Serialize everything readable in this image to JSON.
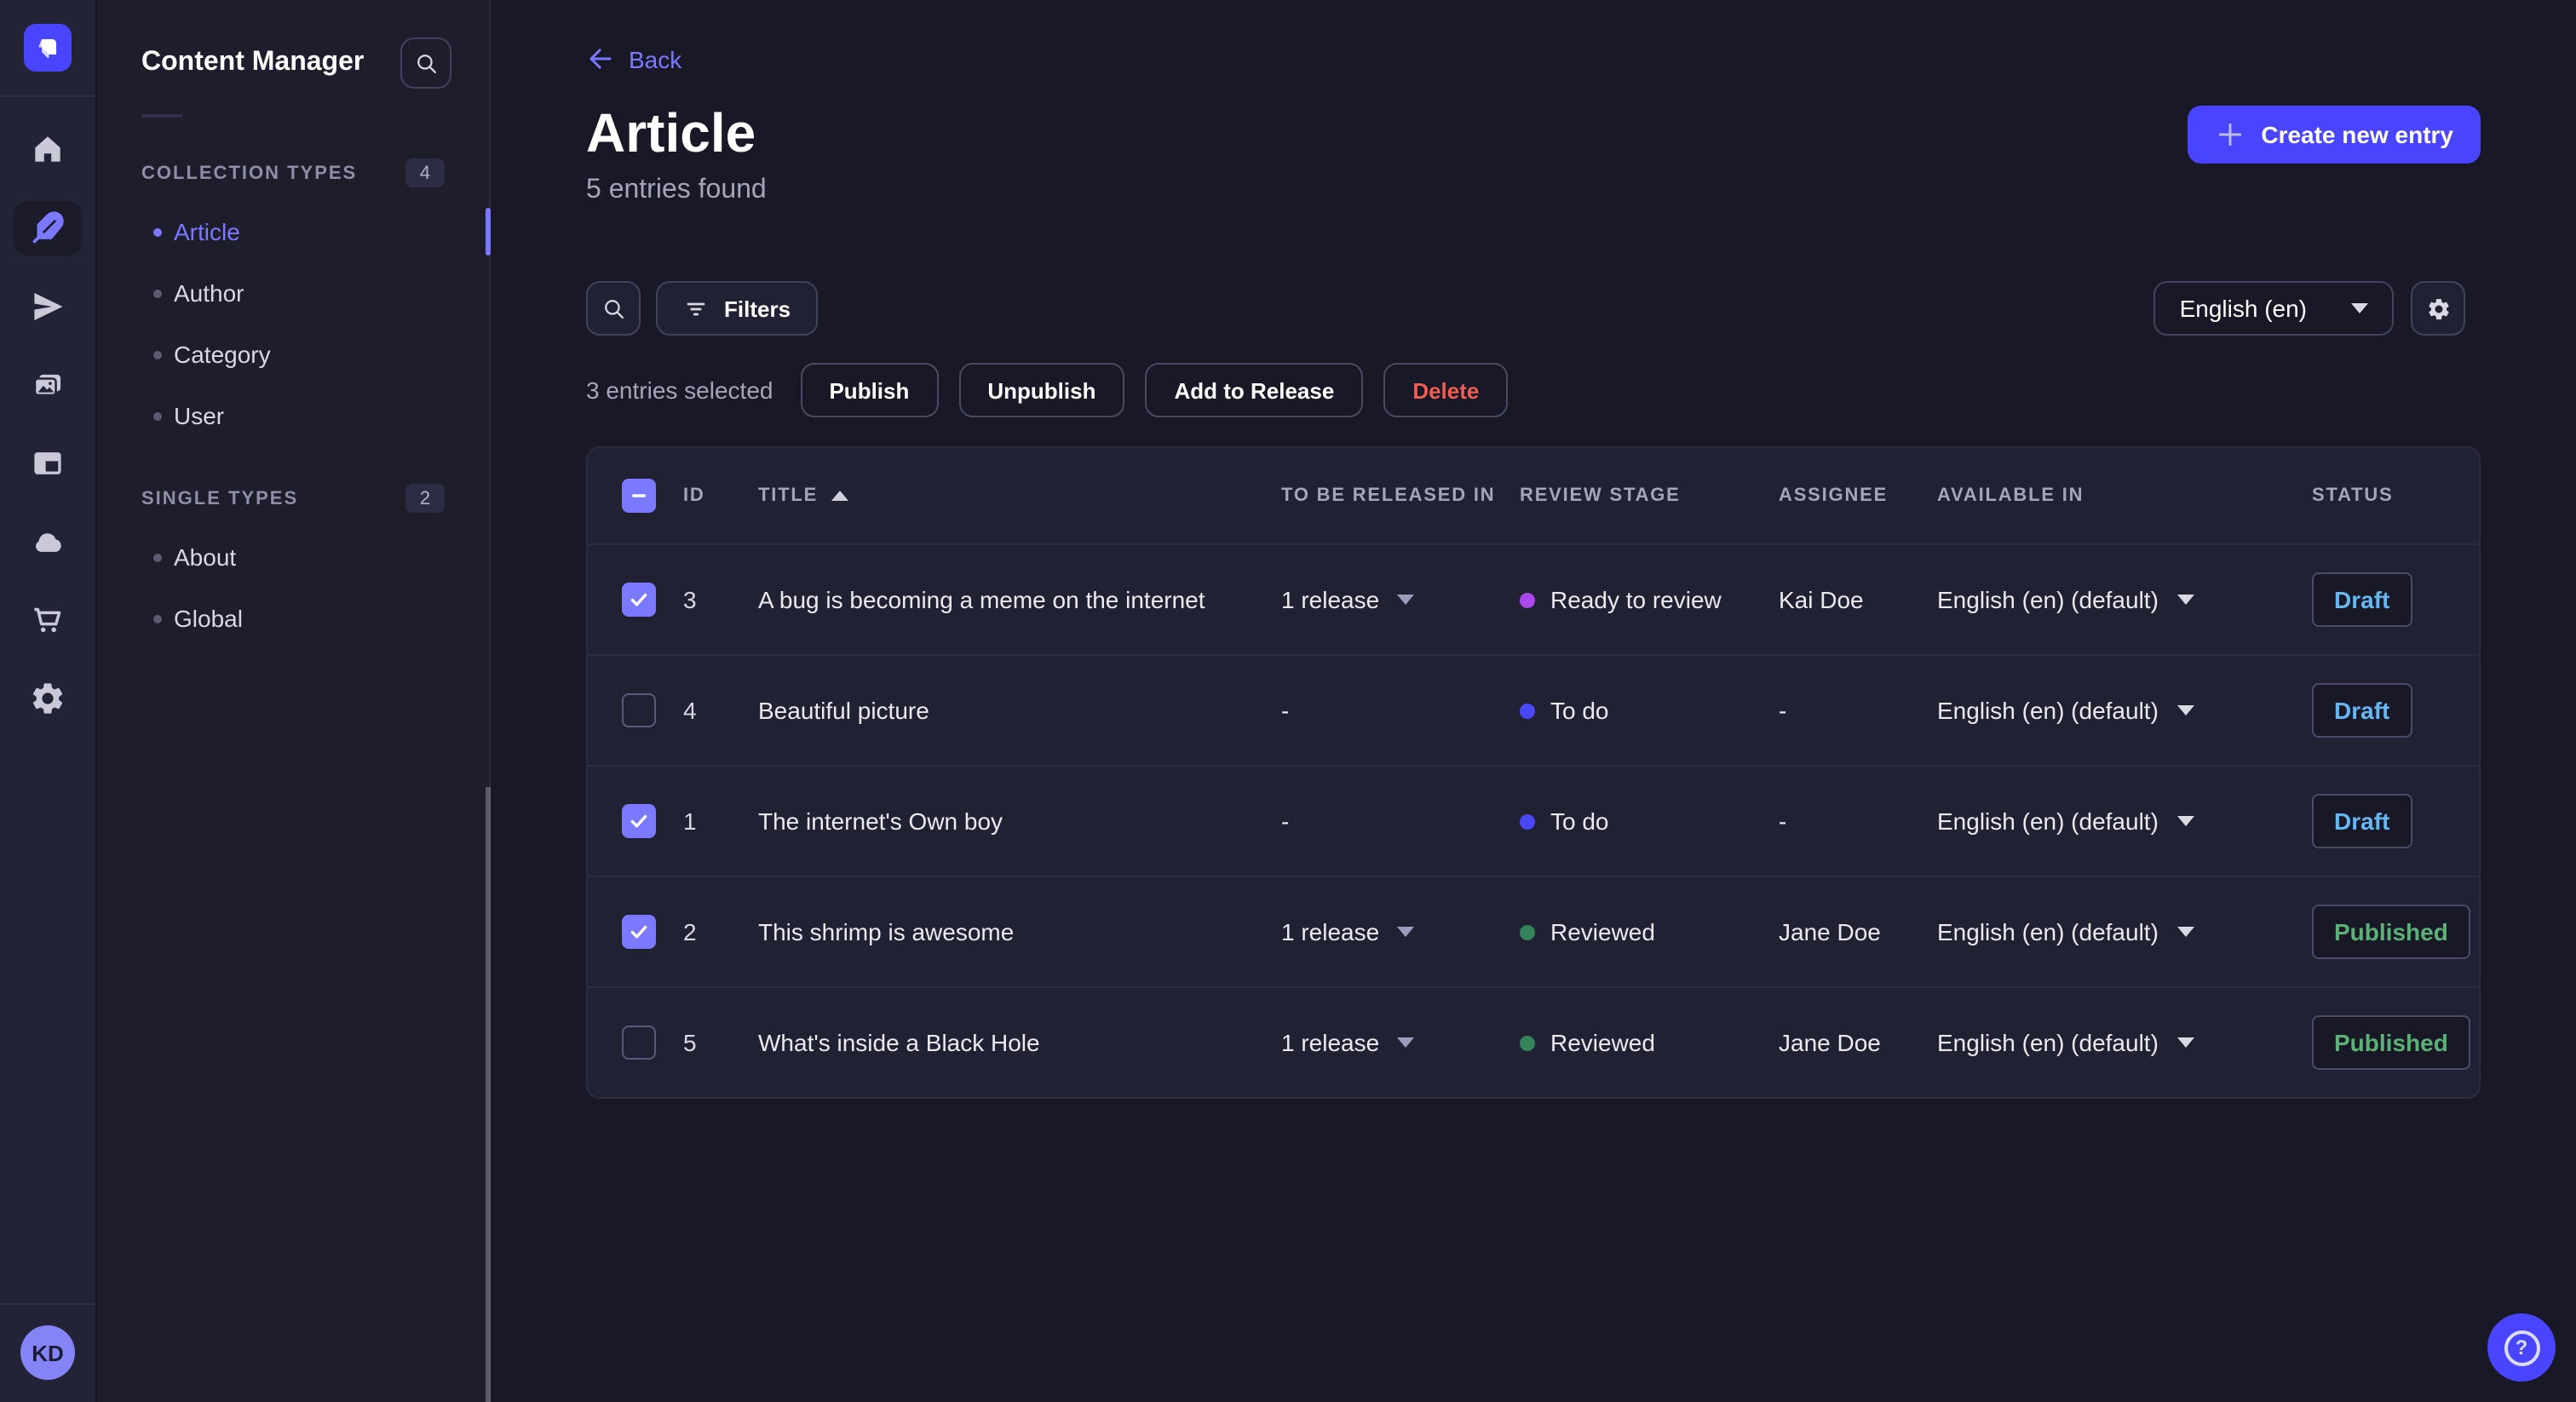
{
  "app": {
    "primary_color": "#4945ff",
    "accent_color": "#7b79ff"
  },
  "rail": {
    "logo_icon": "strapi-logo",
    "items": [
      {
        "name": "home",
        "icon": "home-icon",
        "active": false
      },
      {
        "name": "content-manager",
        "icon": "feather-icon",
        "active": true
      },
      {
        "name": "releases",
        "icon": "paper-plane-icon",
        "active": false
      },
      {
        "name": "media-library",
        "icon": "images-icon",
        "active": false
      },
      {
        "name": "content-type-builder",
        "icon": "layout-icon",
        "active": false
      },
      {
        "name": "deploy",
        "icon": "cloud-icon",
        "active": false
      },
      {
        "name": "marketplace",
        "icon": "cart-icon",
        "active": false
      },
      {
        "name": "settings",
        "icon": "gear-icon",
        "active": false
      }
    ],
    "avatar_initials": "KD"
  },
  "subnav": {
    "title": "Content Manager",
    "search_icon": "search-icon",
    "sections": [
      {
        "label": "COLLECTION TYPES",
        "count": "4",
        "items": [
          {
            "label": "Article",
            "active": true
          },
          {
            "label": "Author",
            "active": false
          },
          {
            "label": "Category",
            "active": false
          },
          {
            "label": "User",
            "active": false
          }
        ]
      },
      {
        "label": "SINGLE TYPES",
        "count": "2",
        "items": [
          {
            "label": "About",
            "active": false
          },
          {
            "label": "Global",
            "active": false
          }
        ]
      }
    ]
  },
  "header": {
    "back": "Back",
    "title": "Article",
    "subtitle": "5 entries found",
    "create_button": "Create new entry"
  },
  "toolbar": {
    "filters": "Filters",
    "language": "English (en)"
  },
  "selection": {
    "label": "3 entries selected",
    "publish": "Publish",
    "unpublish": "Unpublish",
    "add_to_release": "Add to Release",
    "delete": "Delete"
  },
  "table": {
    "header_checkbox": "indeterminate",
    "sort": {
      "column": "TITLE",
      "direction": "asc"
    },
    "columns": {
      "id": "ID",
      "title": "TITLE",
      "release": "TO BE RELEASED IN",
      "stage": "REVIEW STAGE",
      "assignee": "ASSIGNEE",
      "available": "AVAILABLE IN",
      "status": "STATUS"
    },
    "status_colors": {
      "Draft": "#66b7f1",
      "Published": "#5cb176"
    },
    "rows": [
      {
        "checked": true,
        "id": "3",
        "title": "A bug is becoming a meme on the internet",
        "release": "1 release",
        "release_menu": true,
        "stage": "Ready to review",
        "stage_color": "#ab4aea",
        "assignee": "Kai Doe",
        "locale": "English (en) (default)",
        "status": "Draft"
      },
      {
        "checked": false,
        "id": "4",
        "title": "Beautiful picture",
        "release": "-",
        "release_menu": false,
        "stage": "To do",
        "stage_color": "#4a48f5",
        "assignee": "-",
        "locale": "English (en) (default)",
        "status": "Draft"
      },
      {
        "checked": true,
        "id": "1",
        "title": "The internet's Own boy",
        "release": "-",
        "release_menu": false,
        "stage": "To do",
        "stage_color": "#4a48f5",
        "assignee": "-",
        "locale": "English (en) (default)",
        "status": "Draft"
      },
      {
        "checked": true,
        "id": "2",
        "title": "This shrimp is awesome",
        "release": "1 release",
        "release_menu": true,
        "stage": "Reviewed",
        "stage_color": "#35835a",
        "assignee": "Jane Doe",
        "locale": "English (en) (default)",
        "status": "Published"
      },
      {
        "checked": false,
        "id": "5",
        "title": "What's inside a Black Hole",
        "release": "1 release",
        "release_menu": true,
        "stage": "Reviewed",
        "stage_color": "#35835a",
        "assignee": "Jane Doe",
        "locale": "English (en) (default)",
        "status": "Published"
      }
    ]
  },
  "fab": {
    "icon": "question-icon",
    "glyph": "?"
  }
}
